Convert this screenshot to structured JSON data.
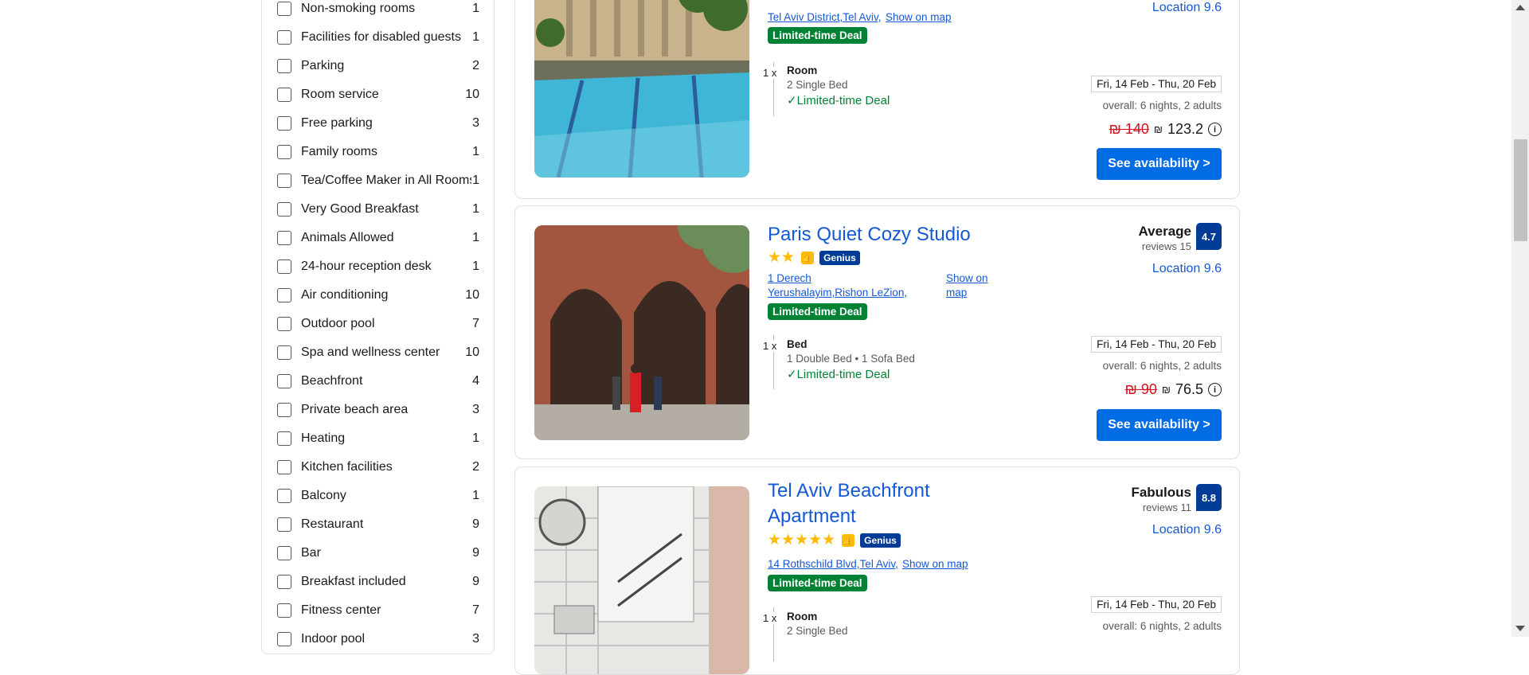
{
  "filters": [
    {
      "label": "Non-smoking rooms",
      "count": "1"
    },
    {
      "label": "Facilities for disabled guests",
      "count": "1"
    },
    {
      "label": "Parking",
      "count": "2"
    },
    {
      "label": "Room service",
      "count": "10"
    },
    {
      "label": "Free parking",
      "count": "3"
    },
    {
      "label": "Family rooms",
      "count": "1"
    },
    {
      "label": "Tea/Coffee Maker in All Rooms",
      "count": "1"
    },
    {
      "label": "Very Good Breakfast",
      "count": "1"
    },
    {
      "label": "Animals Allowed",
      "count": "1"
    },
    {
      "label": "24-hour reception desk",
      "count": "1"
    },
    {
      "label": "Air conditioning",
      "count": "10"
    },
    {
      "label": "Outdoor pool",
      "count": "7"
    },
    {
      "label": "Spa and wellness center",
      "count": "10"
    },
    {
      "label": "Beachfront",
      "count": "4"
    },
    {
      "label": "Private beach area",
      "count": "3"
    },
    {
      "label": "Heating",
      "count": "1"
    },
    {
      "label": "Kitchen facilities",
      "count": "2"
    },
    {
      "label": "Balcony",
      "count": "1"
    },
    {
      "label": "Restaurant",
      "count": "9"
    },
    {
      "label": "Bar",
      "count": "9"
    },
    {
      "label": "Breakfast included",
      "count": "9"
    },
    {
      "label": "Fitness center",
      "count": "7"
    },
    {
      "label": "Indoor pool",
      "count": "3"
    }
  ],
  "cards": [
    {
      "address": "Tel Aviv District,Tel Aviv,",
      "map_link": "Show on map",
      "deal_badge": "Limited-time Deal",
      "qty": "1 x",
      "room_type": "Room",
      "beds": "2 Single Bed",
      "room_deal": "Limited-time Deal",
      "location": "Location 9.6",
      "dates": "Fri, 14 Feb - Thu, 20 Feb",
      "overall": "overall: 6 nights, 2 adults",
      "old_price": "₪ 140",
      "currency": "₪",
      "price": "123.2",
      "button": "See availability >"
    },
    {
      "title": "Paris Quiet Cozy Studio",
      "stars": "★★",
      "genius": "Genius",
      "address": "1 Derech Yerushalayim,Rishon LeZion,",
      "map_link": "Show on map",
      "deal_badge": "Limited-time Deal",
      "score_word": "Average",
      "reviews": "reviews 15",
      "score": "4.7",
      "location": "Location 9.6",
      "qty": "1 x",
      "room_type": "Bed",
      "beds": "1 Double Bed • 1 Sofa Bed",
      "room_deal": "Limited-time Deal",
      "dates": "Fri, 14 Feb - Thu, 20 Feb",
      "overall": "overall: 6 nights, 2 adults",
      "old_price": "₪ 90",
      "currency": "₪",
      "price": "76.5",
      "button": "See availability >"
    },
    {
      "title": "Tel Aviv Beachfront Apartment",
      "stars": "★★★★★",
      "genius": "Genius",
      "address": "14 Rothschild Blvd,Tel Aviv,",
      "map_link": "Show on map",
      "deal_badge": "Limited-time Deal",
      "score_word": "Fabulous",
      "reviews": "reviews 11",
      "score": "8.8",
      "location": "Location 9.6",
      "qty": "1 x",
      "room_type": "Room",
      "beds": "2 Single Bed",
      "dates": "Fri, 14 Feb - Thu, 20 Feb",
      "overall": "overall: 6 nights, 2 adults"
    }
  ],
  "icons": {
    "check": "check-icon",
    "info": "info-icon",
    "thumbs": "thumbs-up-icon"
  },
  "colors": {
    "accent": "#006ce4",
    "deal": "#008234",
    "score": "#003b95",
    "link": "#1458d6",
    "stars": "#febb02"
  }
}
